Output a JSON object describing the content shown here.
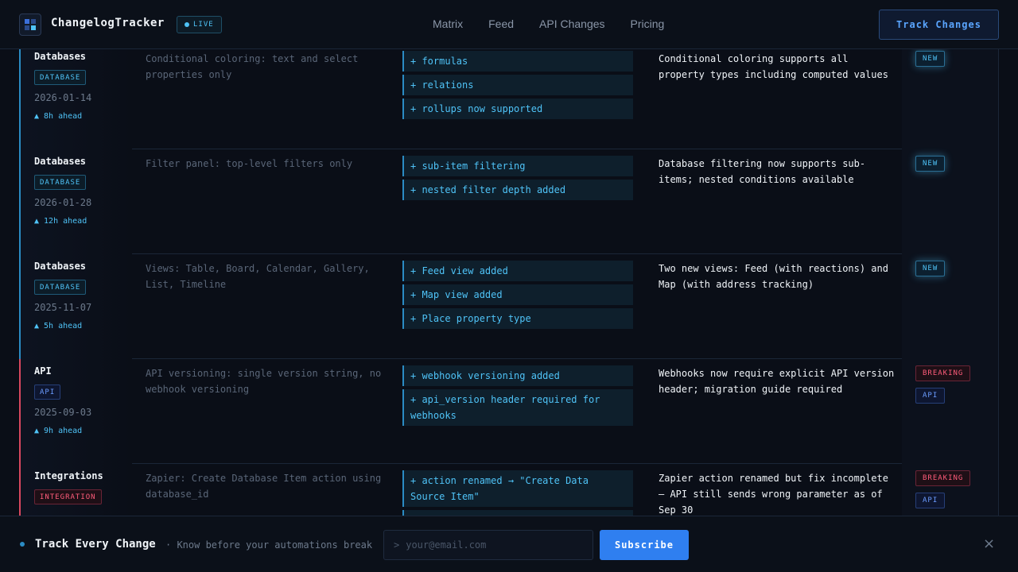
{
  "header": {
    "brand": "ChangelogTracker",
    "live_label": "LIVE",
    "nav": [
      "Matrix",
      "Feed",
      "API Changes",
      "Pricing"
    ],
    "cta": "Track Changes"
  },
  "rows": [
    {
      "feature": "Databases",
      "tag": "DATABASE",
      "date": "2026-01-14",
      "ahead": "▲ 8h ahead",
      "before": "Conditional coloring: text and select properties only",
      "changes": [
        "+ formulas",
        "+ relations",
        "+ rollups now supported"
      ],
      "after": "Conditional coloring supports all property types including computed values",
      "status": [
        "NEW"
      ]
    },
    {
      "feature": "Databases",
      "tag": "DATABASE",
      "date": "2026-01-28",
      "ahead": "▲ 12h ahead",
      "before": "Filter panel: top-level filters only",
      "changes": [
        "+ sub-item filtering",
        "+ nested filter depth added"
      ],
      "after": "Database filtering now supports sub-items; nested conditions available",
      "status": [
        "NEW"
      ]
    },
    {
      "feature": "Databases",
      "tag": "DATABASE",
      "date": "2025-11-07",
      "ahead": "▲ 5h ahead",
      "before": "Views: Table, Board, Calendar, Gallery, List, Timeline",
      "changes": [
        "+ Feed view added",
        "+ Map view added",
        "+ Place property type"
      ],
      "after": "Two new views: Feed (with reactions) and Map (with address tracking)",
      "status": [
        "NEW"
      ]
    },
    {
      "feature": "API",
      "tag": "API",
      "date": "2025-09-03",
      "ahead": "▲ 9h ahead",
      "before": "API versioning: single version string, no webhook versioning",
      "changes": [
        "+ webhook versioning added",
        "+ api_version header required for webhooks"
      ],
      "after": "Webhooks now require explicit API version header; migration guide required",
      "status": [
        "BREAKING",
        "API"
      ]
    },
    {
      "feature": "Integrations",
      "tag": "INTEGRATION",
      "date": "",
      "ahead": "",
      "before": "Zapier: Create Database Item action using database_id",
      "changes": [
        "+ action renamed → \"Create Data Source Item\"",
        ""
      ],
      "after": "Zapier action renamed but fix incomplete — API still sends wrong parameter as of Sep 30",
      "status": [
        "BREAKING",
        "API"
      ]
    }
  ],
  "colors": {
    "accent_database": "#2b8cc4",
    "accent_breaking": "#d9485f",
    "subscribe": "#2f7ff0"
  },
  "footer": {
    "title": "Track Every Change",
    "subtitle": "· Know before your automations break",
    "email_prefix": ">",
    "email_placeholder": "your@email.com",
    "subscribe": "Subscribe",
    "close": "×"
  }
}
